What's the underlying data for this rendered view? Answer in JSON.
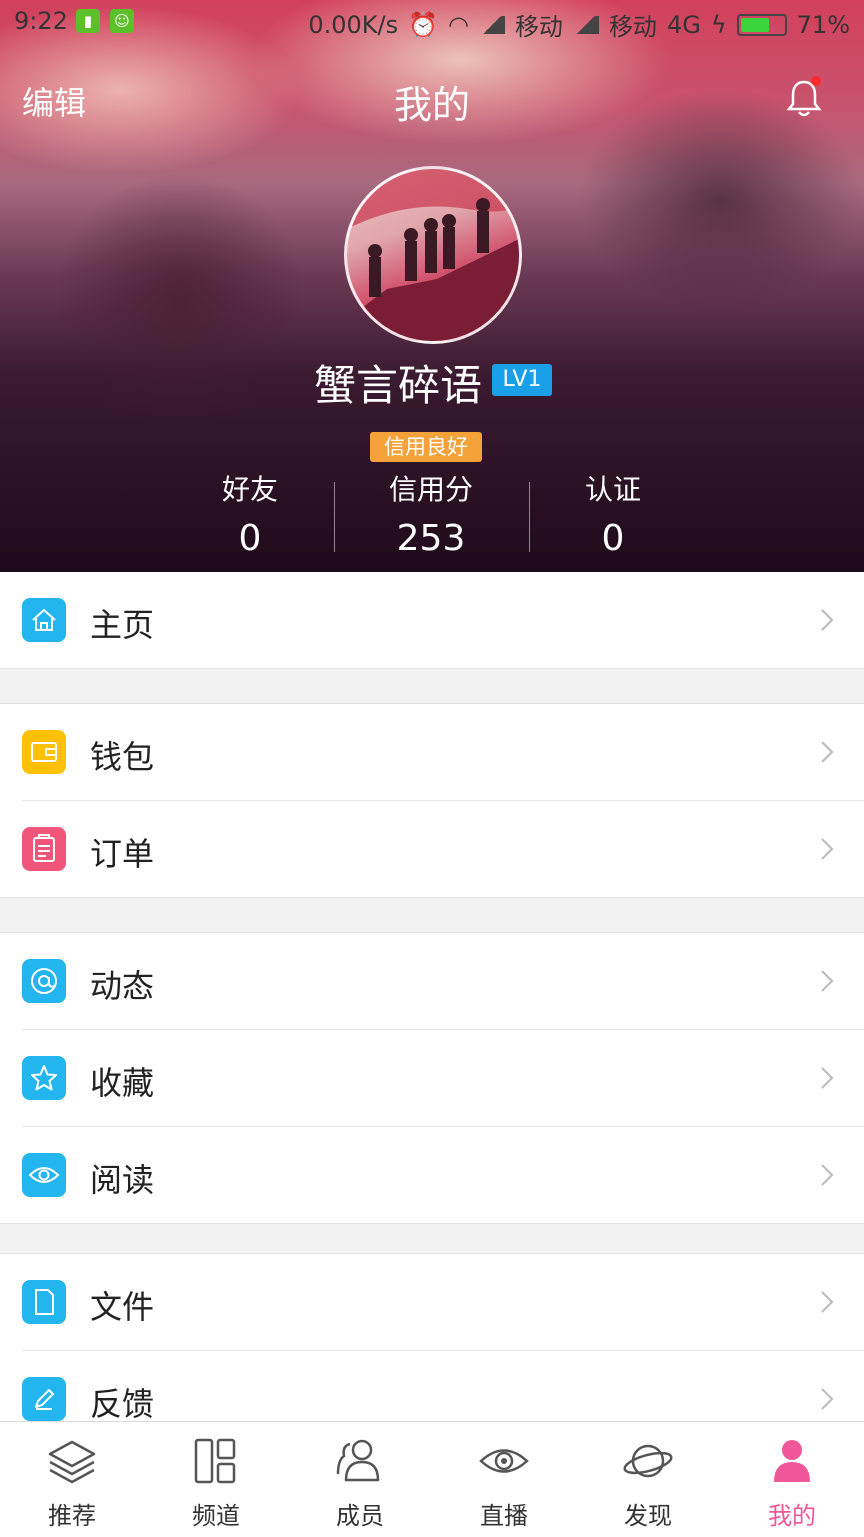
{
  "status_bar": {
    "time": "9:22",
    "network_speed": "0.00K/s",
    "carrier1": "移动",
    "carrier2": "移动",
    "network_type": "4G",
    "battery_percent": "71%",
    "battery_level": 0.71
  },
  "header": {
    "edit_label": "编辑",
    "title": "我的",
    "notification_dot": true
  },
  "profile": {
    "username": "蟹言碎语",
    "level": "LV1",
    "credit_badge": "信用良好",
    "stats": [
      {
        "label": "好友",
        "value": "0"
      },
      {
        "label": "信用分",
        "value": "253"
      },
      {
        "label": "认证",
        "value": "0"
      }
    ]
  },
  "menu": {
    "groups": [
      [
        {
          "label": "主页",
          "icon": "home-icon",
          "color": "#22b5ee"
        }
      ],
      [
        {
          "label": "钱包",
          "icon": "wallet-icon",
          "color": "#ffc107"
        },
        {
          "label": "订单",
          "icon": "clipboard-icon",
          "color": "#f2557a"
        }
      ],
      [
        {
          "label": "动态",
          "icon": "at-icon",
          "color": "#22b5ee"
        },
        {
          "label": "收藏",
          "icon": "star-icon",
          "color": "#22b5ee"
        },
        {
          "label": "阅读",
          "icon": "eye-icon",
          "color": "#22b5ee"
        }
      ],
      [
        {
          "label": "文件",
          "icon": "file-icon",
          "color": "#22b5ee"
        },
        {
          "label": "反馈",
          "icon": "pencil-icon",
          "color": "#22b5ee"
        }
      ]
    ]
  },
  "tabbar": {
    "tabs": [
      {
        "label": "推荐",
        "icon": "layers-icon"
      },
      {
        "label": "频道",
        "icon": "grid-icon"
      },
      {
        "label": "成员",
        "icon": "users-icon"
      },
      {
        "label": "直播",
        "icon": "eye-icon"
      },
      {
        "label": "发现",
        "icon": "planet-icon"
      },
      {
        "label": "我的",
        "icon": "person-icon"
      }
    ],
    "active_index": 5,
    "active_color": "#f0569a"
  }
}
